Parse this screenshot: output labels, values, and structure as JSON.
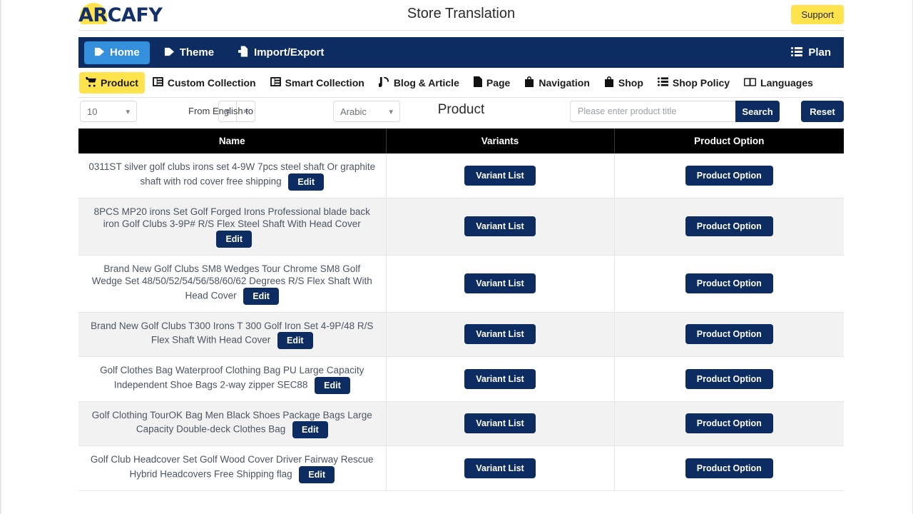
{
  "header": {
    "logo_text": "ARCAFY",
    "logo_icon": "arcafy-logo",
    "title": "Store Translation",
    "support_label": "Support"
  },
  "mainnav": {
    "items": [
      {
        "label": "Home",
        "icon": "tag-icon",
        "active": true
      },
      {
        "label": "Theme",
        "icon": "tag-icon",
        "active": false
      },
      {
        "label": "Import/Export",
        "icon": "file-export-icon",
        "active": false
      }
    ],
    "plan": {
      "label": "Plan",
      "icon": "list-icon"
    }
  },
  "subnav": {
    "items": [
      {
        "label": "Product",
        "icon": "cart-icon",
        "active": true
      },
      {
        "label": "Custom Collection",
        "icon": "collection-icon",
        "active": false
      },
      {
        "label": "Smart Collection",
        "icon": "collection-icon",
        "active": false
      },
      {
        "label": "Blog & Article",
        "icon": "blog-icon",
        "active": false
      },
      {
        "label": "Page",
        "icon": "page-icon",
        "active": false
      },
      {
        "label": "Navigation",
        "icon": "bag-icon",
        "active": false
      },
      {
        "label": "Shop",
        "icon": "bag-icon",
        "active": false
      },
      {
        "label": "Shop Policy",
        "icon": "list-icon",
        "active": false
      },
      {
        "label": "Languages",
        "icon": "languages-icon",
        "active": false
      }
    ]
  },
  "controls": {
    "page_size": "10",
    "prev_label": "«",
    "next_label": "»",
    "from_label": "From English to",
    "target_language": "Arabic",
    "section_title": "Product",
    "search_placeholder": "Please enter product title",
    "search_value": "",
    "search_label": "Search",
    "reset_label": "Reset"
  },
  "table": {
    "columns": [
      "Name",
      "Variants",
      "Product Option"
    ],
    "edit_label": "Edit",
    "variant_label": "Variant List",
    "option_label": "Product Option",
    "rows": [
      {
        "name": "0311ST silver golf clubs irons set 4-9W 7pcs steel shaft Or graphite shaft with rod cover free shipping"
      },
      {
        "name": "8PCS MP20 irons Set Golf Forged Irons Professional blade back iron Golf Clubs 3-9P# R/S Flex Steel Shaft With Head Cover"
      },
      {
        "name": "Brand New Golf Clubs SM8 Wedges Tour Chrome SM8 Golf Wedge Set 48/50/52/54/56/58/60/62 Degrees R/S Flex Shaft With Head Cover"
      },
      {
        "name": "Brand New Golf Clubs T300 Irons T 300 Golf Iron Set 4-9P/48 R/S Flex Shaft With Head Cover"
      },
      {
        "name": "Golf Clothes Bag Waterproof Clothing Bag PU Large Capacity Independent Shoe Bags 2-way zipper SEC88"
      },
      {
        "name": "Golf Clothing TourOK Bag Men Black Shoes Package Bags Large Capacity Double-deck Clothes Bag"
      },
      {
        "name": "Golf Club Headcover Set Golf Wood Cover Driver Fairway Rescue Hybrid Headcovers Free Shipping flag"
      }
    ]
  },
  "colors": {
    "navy": "#0d2c62",
    "accent_blue": "#3490dc",
    "yellow": "#ffe34d",
    "header_black": "#000000",
    "row_alt": "#f2f2f2"
  }
}
